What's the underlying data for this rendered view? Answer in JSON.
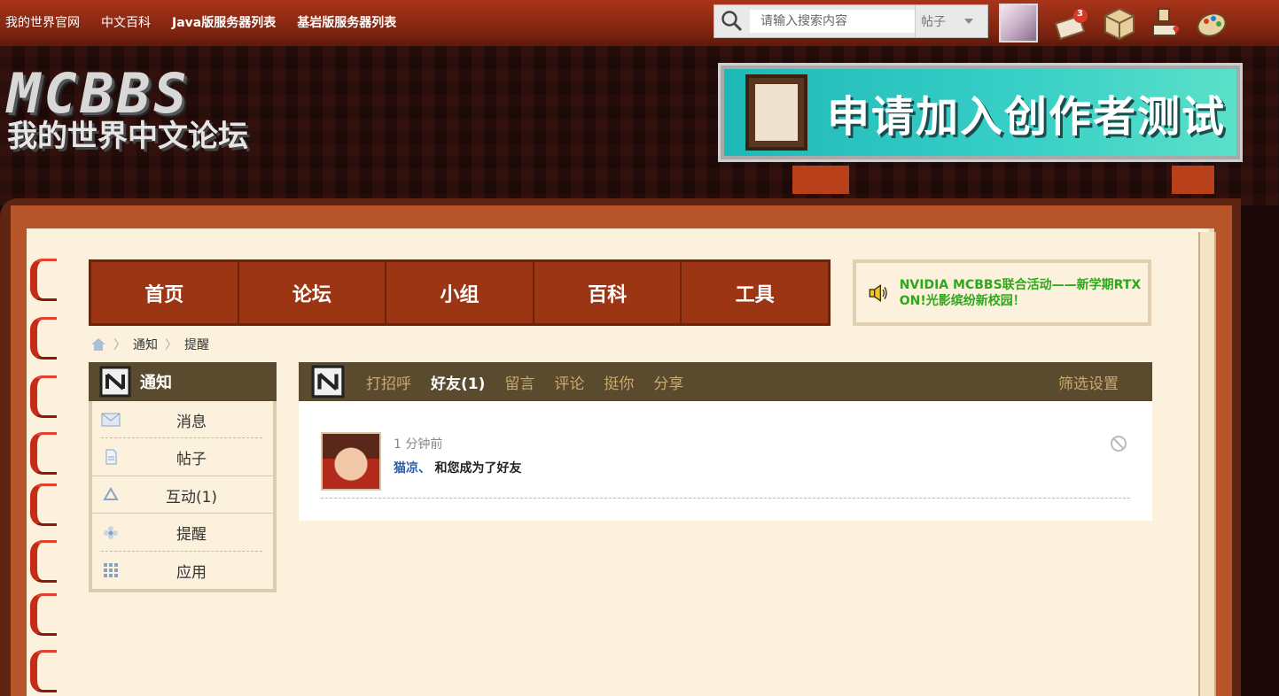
{
  "topbar": {
    "links": [
      "我的世界官网",
      "中文百科",
      "Java版服务器列表",
      "基岩版服务器列表"
    ],
    "search": {
      "placeholder": "请输入搜索内容",
      "type": "帖子"
    },
    "notification_count": "3"
  },
  "header": {
    "logo_main": "MCBBS",
    "logo_sub": "我的世界中文论坛",
    "banner_text": "申请加入创作者测试"
  },
  "nav": {
    "items": [
      "首页",
      "论坛",
      "小组",
      "百科",
      "工具"
    ]
  },
  "notice": {
    "text": "NVIDIA MCBBS联合活动——新学期RTX ON!光影缤纷新校园！"
  },
  "breadcrumb": {
    "items": [
      "通知",
      "提醒"
    ]
  },
  "sidebar": {
    "title": "通知",
    "items": [
      {
        "label": "消息",
        "icon": "envelope-icon"
      },
      {
        "label": "帖子",
        "icon": "document-icon"
      },
      {
        "label": "互动(1)",
        "icon": "recycle-icon"
      },
      {
        "label": "提醒",
        "icon": "flower-icon"
      },
      {
        "label": "应用",
        "icon": "grid-icon"
      }
    ]
  },
  "tabs": {
    "items": [
      "打招呼",
      "好友(1)",
      "留言",
      "评论",
      "挺你",
      "分享"
    ],
    "active": "好友(1)",
    "filter_label": "筛选设置"
  },
  "feed": {
    "time": "1 分钟前",
    "user": "猫凉",
    "separator": "、",
    "message": "和您成为了好友"
  },
  "colors": {
    "topbar": "#8a2a12",
    "nav": "#9b3514",
    "tab_bar": "#5a4a2e",
    "notice_text": "#2ea81a",
    "link_blue": "#2a5ea8"
  }
}
